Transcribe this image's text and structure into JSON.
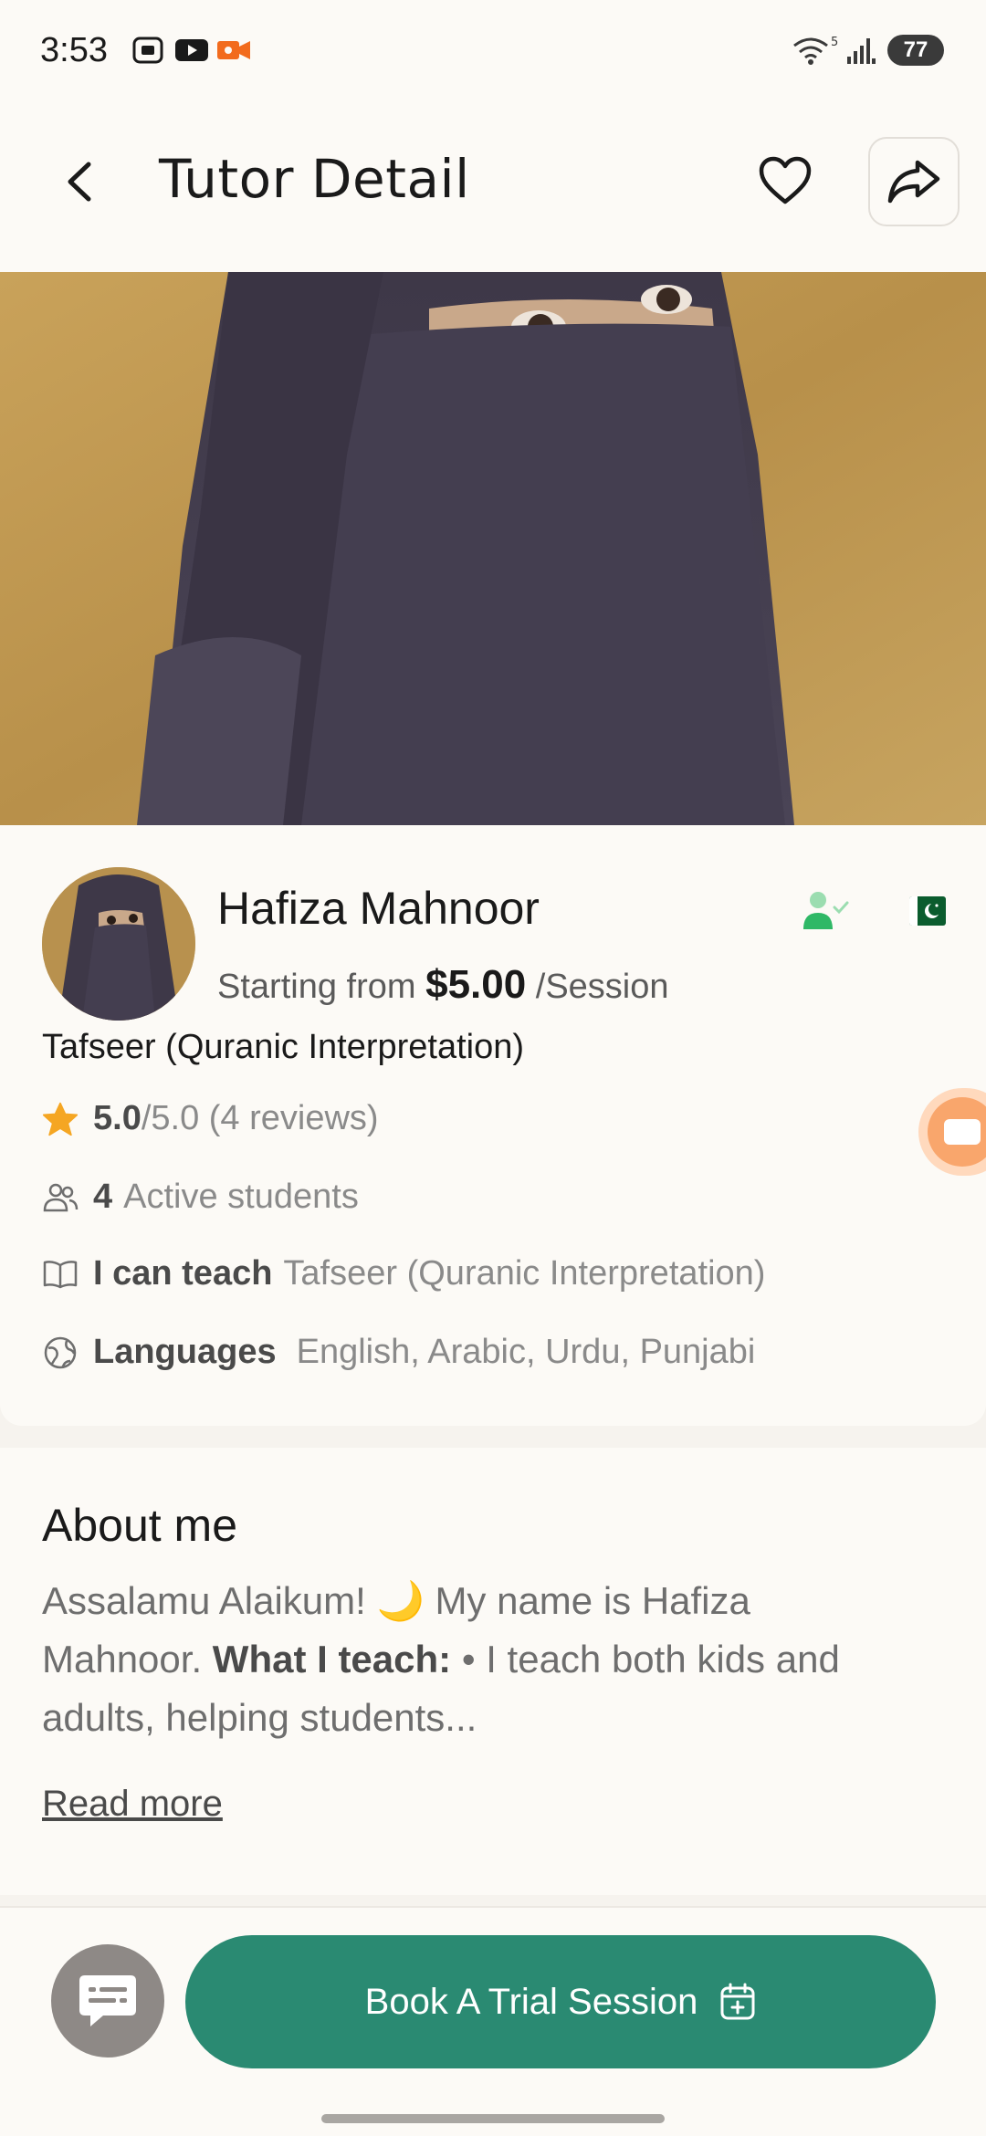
{
  "status_bar": {
    "time": "3:53",
    "battery": "77",
    "network_badge": "5"
  },
  "header": {
    "title": "Tutor Detail",
    "back_icon": "back-arrow-icon",
    "favorite_icon": "heart-icon",
    "share_icon": "share-icon"
  },
  "tutor": {
    "name": "Hafiza Mahnoor",
    "price_prefix": "Starting from",
    "price": "$5.00",
    "price_suffix": "/Session",
    "subject": "Tafseer (Quranic Interpretation)",
    "rating_value": "5.0",
    "rating_suffix": "/5.0 (4 reviews)",
    "students_count": "4",
    "students_label": "Active students",
    "teach_label": "I can teach",
    "teach_value": "Tafseer (Quranic Interpretation)",
    "languages_label": "Languages",
    "languages_value": "English, Arabic, Urdu, Punjabi"
  },
  "about": {
    "title": "About me",
    "text_1": "Assalamu Alaikum! 🌙 My name is Hafiza Mahnoor.",
    "text_bold": "What I teach:",
    "text_2": "• I teach both kids and adults, helping students...",
    "read_more": "Read more"
  },
  "bottom": {
    "book_label": "Book A Trial Session",
    "chat_icon": "chat-icon",
    "calendar_icon": "calendar-add-icon"
  },
  "colors": {
    "primary": "#2A8A72",
    "background": "#F6F3EE",
    "surface": "#FCFAF6",
    "star": "#F5A623",
    "video_accent": "#F9A66C"
  }
}
